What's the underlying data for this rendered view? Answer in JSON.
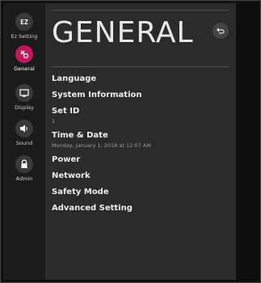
{
  "sidebar": {
    "items": [
      {
        "label": "Ez Setting",
        "icon": "ez-icon",
        "glyph": "EZ"
      },
      {
        "label": "General",
        "icon": "general-settings-icon",
        "active": true
      },
      {
        "label": "Display",
        "icon": "display-icon"
      },
      {
        "label": "Sound",
        "icon": "speaker-icon"
      },
      {
        "label": "Admin",
        "icon": "lock-icon"
      }
    ]
  },
  "header": {
    "title": "GENERAL",
    "back_icon": "back-icon"
  },
  "menu": {
    "items": [
      {
        "label": "Language"
      },
      {
        "label": "System Information"
      },
      {
        "label": "Set ID",
        "value": "1"
      },
      {
        "label": "Time & Date",
        "value": "Monday, January 1, 2018 at 12:07 AM"
      },
      {
        "label": "Power"
      },
      {
        "label": "Network"
      },
      {
        "label": "Safety Mode"
      },
      {
        "label": "Advanced Setting"
      }
    ]
  },
  "colors": {
    "accent": "#c4175c",
    "panel": "#2b2b2b",
    "sidebar": "#1b1b1b"
  }
}
